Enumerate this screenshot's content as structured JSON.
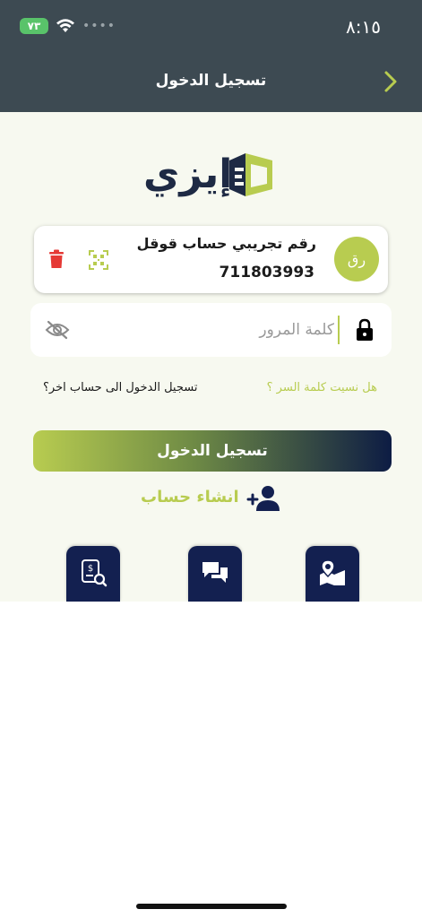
{
  "status_bar": {
    "time": "٨:١٥",
    "battery": "٧٣"
  },
  "header": {
    "title": "تسجيل الدخول"
  },
  "logo": {
    "text": "إيزي"
  },
  "account_card": {
    "avatar_initials": "رق",
    "name": "رقم تجريبي حساب قوقل",
    "number": "711803993"
  },
  "password": {
    "placeholder": "كلمة المرور"
  },
  "links": {
    "forgot": "هل نسيت كلمة السر ؟",
    "other_account": "تسجيل الدخول الى حساب اخر؟"
  },
  "login_button": {
    "label": "تسجيل الدخول"
  },
  "create_account": {
    "label": "انشاء حساب"
  },
  "colors": {
    "header_bg": "#3d4a52",
    "accent_green": "#b8cc50",
    "navy": "#132050",
    "page_bg": "#f7f9f0",
    "danger": "#e53935"
  },
  "icons": [
    "back-chevron-icon",
    "wifi-icon",
    "qr-code-icon",
    "trash-icon",
    "lock-icon",
    "eye-off-icon",
    "add-user-icon",
    "receipt-search-icon",
    "chat-icon",
    "map-location-icon"
  ]
}
